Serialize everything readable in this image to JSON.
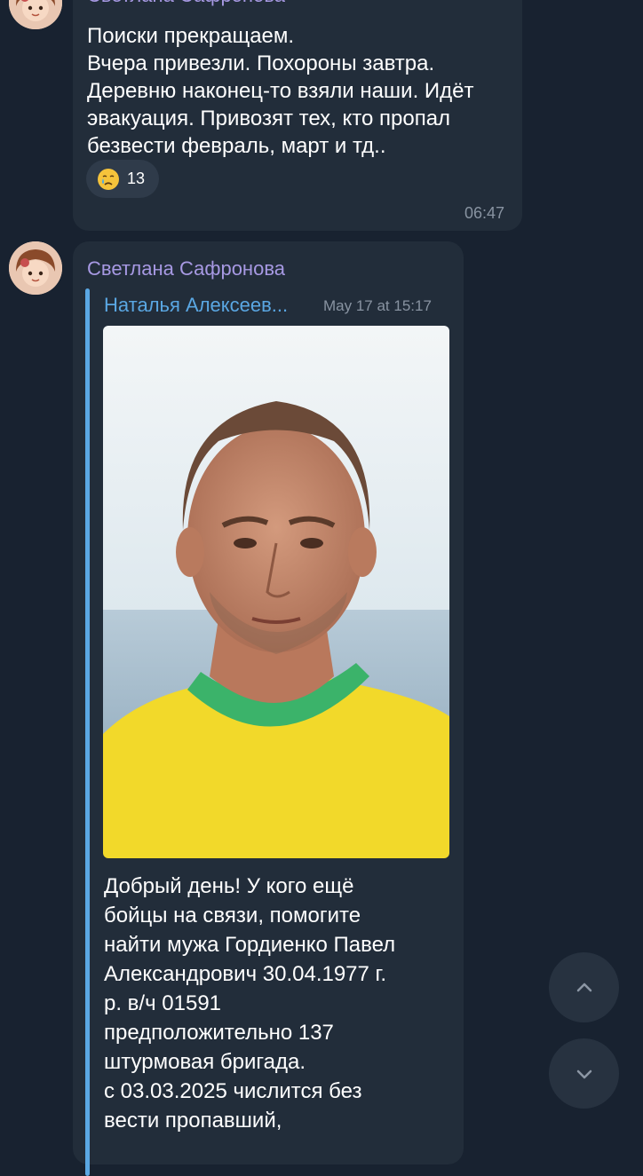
{
  "messages": [
    {
      "sender": "Светлана Сафронова",
      "text": "Поиски прекращаем.\nВчера привезли. Похороны завтра.\nДеревню наконец-то взяли наши. Идёт\nэвакуация. Привозят тех, кто пропал\nбезвести февраль, март и тд..",
      "reaction": {
        "emoji": "crying-face-icon",
        "count": "13"
      },
      "time": "06:47"
    },
    {
      "sender": "Светлана Сафронова",
      "forwarded": {
        "from": "Наталья Алексеев...",
        "date": "May 17 at 15:17",
        "photo": "photo of a man in a yellow t-shirt with green collar, sea background"
      },
      "text": "Добрый день! У кого ещё\nбойцы на связи, помогите\nнайти мужа Гордиенко Павел\nАлександрович 30.04.1977 г.\nр. в/ч 01591\nпредположительно 137\nштурмовая бригада.\nс 03.03.2025 числится без\nвести пропавший,"
    }
  ],
  "controls": {
    "scroll_up_icon": "chevron-up-icon",
    "scroll_down_icon": "chevron-down-icon"
  },
  "colors": {
    "background": "#182230",
    "bubble": "#222d3a",
    "sender_name": "#a799e3",
    "forward_accent": "#5aa7e3",
    "timestamp": "#8893a1"
  }
}
